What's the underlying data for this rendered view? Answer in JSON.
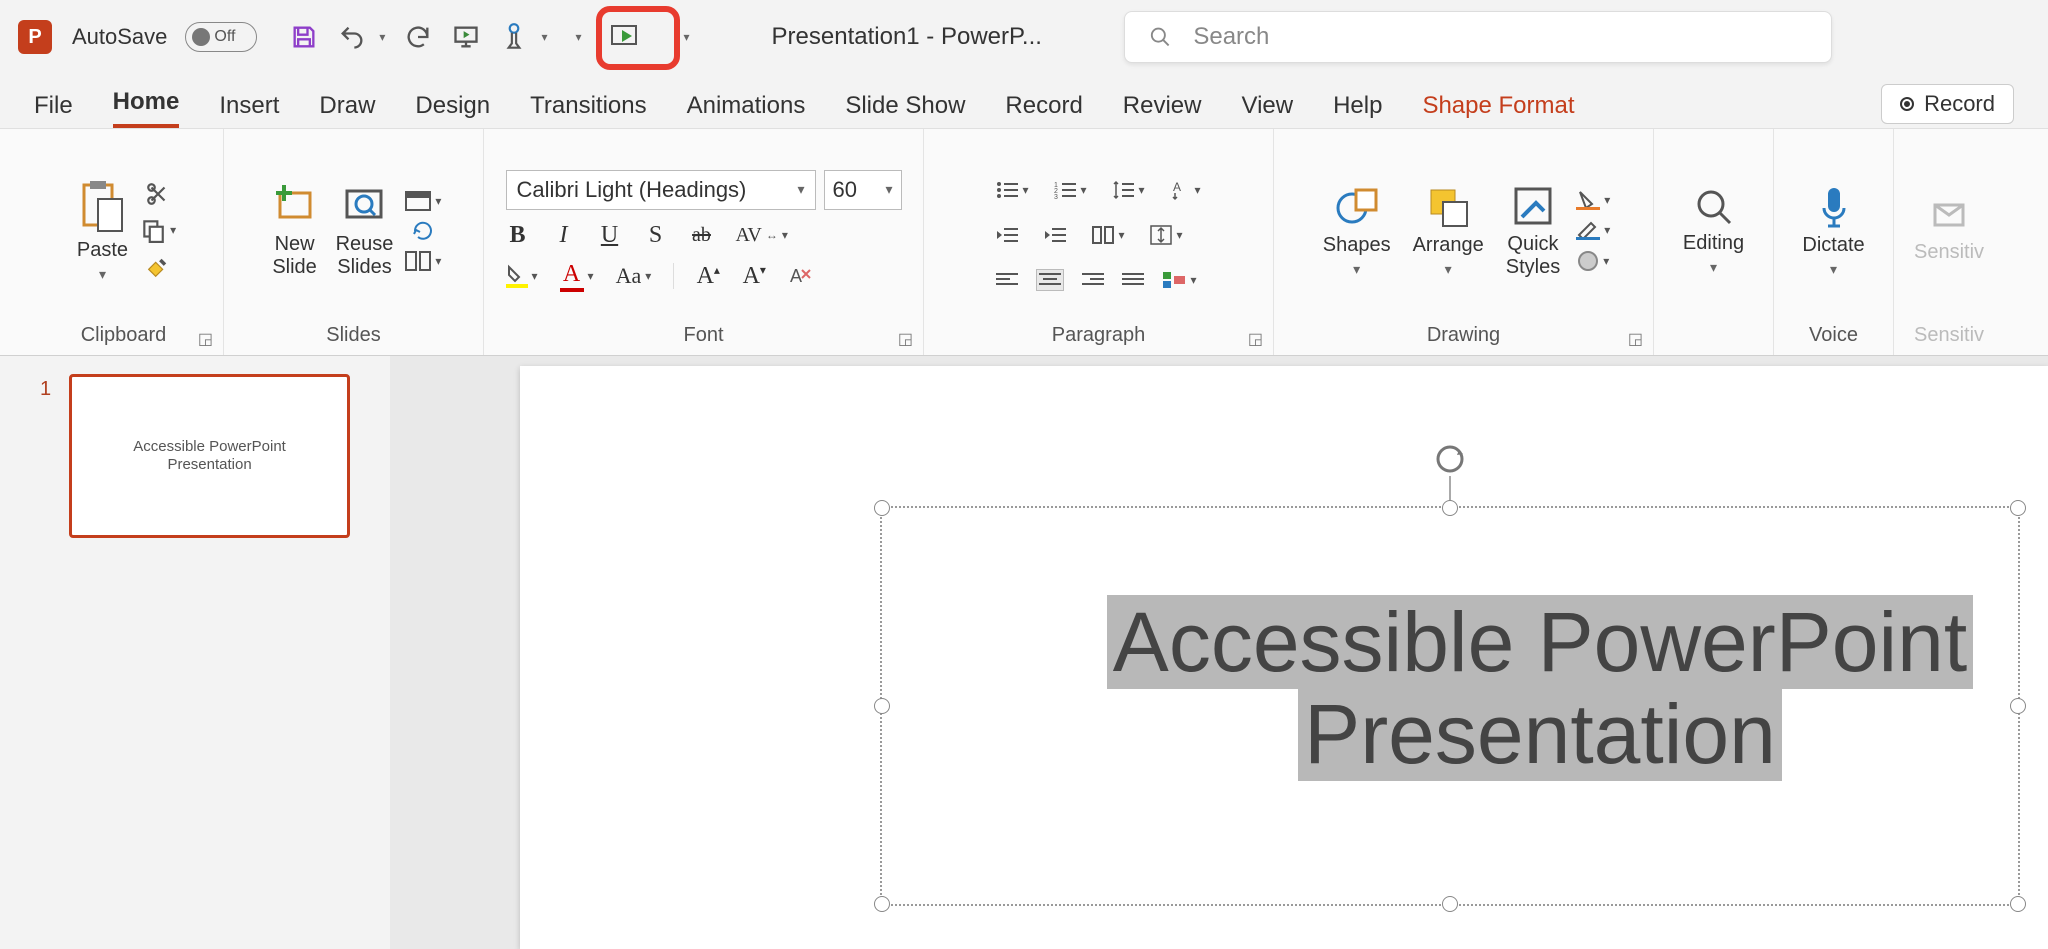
{
  "titlebar": {
    "app_letter": "P",
    "autosave_label": "AutoSave",
    "autosave_state": "Off",
    "doc_title": "Presentation1  -  PowerP...",
    "search_placeholder": "Search"
  },
  "tabs": {
    "file": "File",
    "home": "Home",
    "insert": "Insert",
    "draw": "Draw",
    "design": "Design",
    "transitions": "Transitions",
    "animations": "Animations",
    "slideshow": "Slide Show",
    "record": "Record",
    "review": "Review",
    "view": "View",
    "help": "Help",
    "shape_format": "Shape Format",
    "record_button": "Record"
  },
  "ribbon": {
    "clipboard": {
      "paste": "Paste",
      "label": "Clipboard"
    },
    "slides": {
      "new_slide": "New\nSlide",
      "reuse": "Reuse\nSlides",
      "label": "Slides"
    },
    "font": {
      "name": "Calibri Light (Headings)",
      "size": "60",
      "bold": "B",
      "italic": "I",
      "underline": "U",
      "shadow": "S",
      "strike": "ab",
      "spacing": "AV",
      "case": "Aa",
      "grow": "A",
      "shrink": "A",
      "clear": "A",
      "fontcolor": "A",
      "label": "Font"
    },
    "paragraph": {
      "label": "Paragraph"
    },
    "drawing": {
      "shapes": "Shapes",
      "arrange": "Arrange",
      "quick": "Quick\nStyles",
      "label": "Drawing"
    },
    "editing": {
      "label": "Editing",
      "btn": "Editing"
    },
    "voice": {
      "dictate": "Dictate",
      "label": "Voice"
    },
    "sensitivity": {
      "btn": "Sensitiv",
      "label": "Sensitiv"
    }
  },
  "thumbnails": {
    "num": "1",
    "title": "Accessible PowerPoint\nPresentation"
  },
  "slide": {
    "line1": "Accessible PowerPoint",
    "line2": "Presentation"
  }
}
